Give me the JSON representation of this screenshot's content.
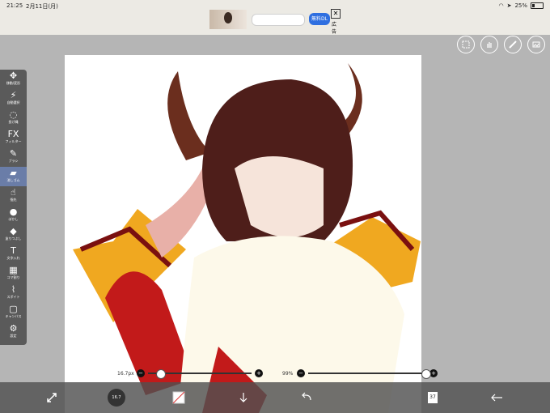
{
  "status": {
    "time": "21:25",
    "date": "2月11日(月)",
    "battery": "25%"
  },
  "ad": {
    "cta_label": "無料DL",
    "close_label": "✕",
    "mark": "広告"
  },
  "toolbar": {
    "tools": [
      {
        "label": "移動/変形",
        "icon": "move-icon"
      },
      {
        "label": "自動選択",
        "icon": "magic-wand-icon"
      },
      {
        "label": "投げ縄",
        "icon": "lasso-icon"
      },
      {
        "label": "フィルター",
        "icon": "filter-icon",
        "glyph": "FX"
      },
      {
        "label": "ブラシ",
        "icon": "brush-icon"
      },
      {
        "label": "消しゴム",
        "icon": "eraser-icon"
      },
      {
        "label": "指先",
        "icon": "smudge-icon"
      },
      {
        "label": "ぼかし",
        "icon": "blur-icon"
      },
      {
        "label": "塗りつぶし",
        "icon": "bucket-icon"
      },
      {
        "label": "文字入れ",
        "icon": "text-icon",
        "glyph": "T"
      },
      {
        "label": "コマ割り",
        "icon": "frame-icon"
      },
      {
        "label": "スポイト",
        "icon": "eyedropper-icon"
      },
      {
        "label": "キャンバス",
        "icon": "canvas-icon"
      },
      {
        "label": "設定",
        "icon": "gear-icon"
      }
    ]
  },
  "sliders": {
    "size_label": "16.7px",
    "size_level": 0.12,
    "opacity_label": "99%",
    "opacity_level": 0.99,
    "minus": "−",
    "plus": "+"
  },
  "bottom": {
    "brush_size": "16.7",
    "layer_count": "37"
  },
  "colors": {
    "toolbar_bg": "#5a5a5a",
    "active_tool": "#6a7da8",
    "ad_cta": "#2f6fe0"
  }
}
